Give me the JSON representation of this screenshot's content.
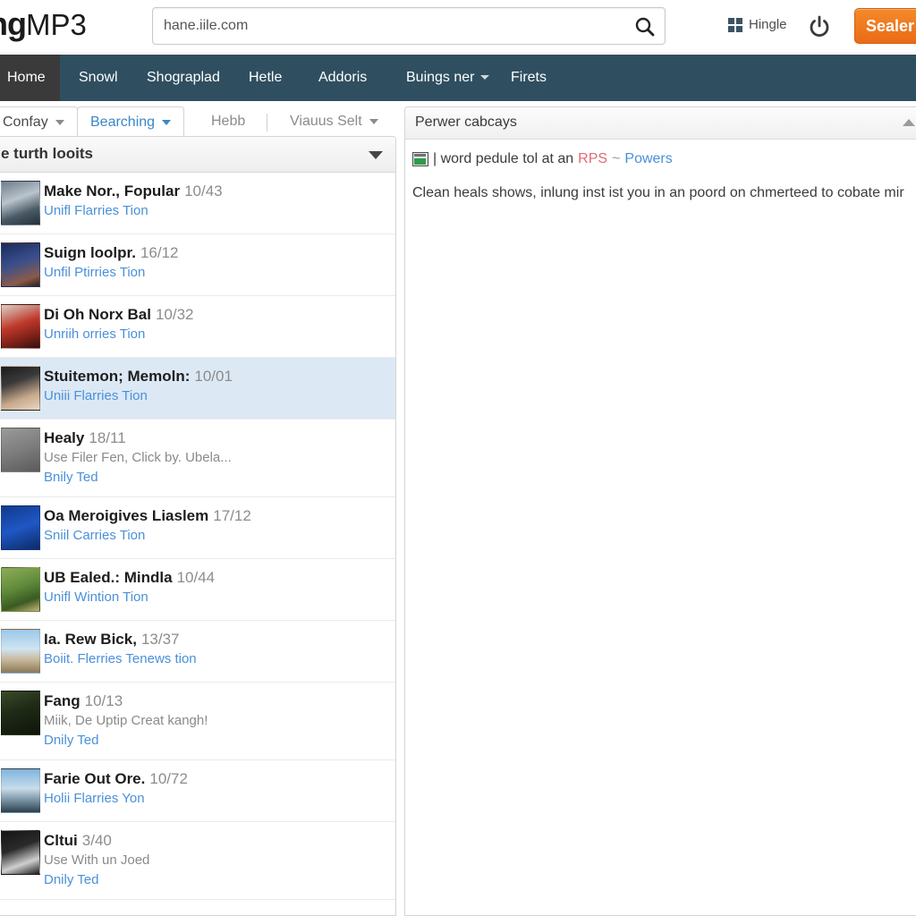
{
  "header": {
    "logo_bold": "ing",
    "logo_thin": "MP3",
    "search": {
      "value": "hane.iile.com",
      "placeholder": "hane.iile.com",
      "icon": "search-icon"
    },
    "hingle_label": "Hingle",
    "hingle_icon": "windows-grid-icon",
    "power_icon": "power-icon",
    "sealer_label": "Sealer"
  },
  "nav": {
    "items": [
      {
        "label": "Home",
        "active": true,
        "caret": false
      },
      {
        "label": "Snowl",
        "active": false,
        "caret": false
      },
      {
        "label": "Shograplad",
        "active": false,
        "caret": false
      },
      {
        "label": "Hetle",
        "active": false,
        "caret": false
      },
      {
        "label": "Addoris",
        "active": false,
        "caret": false
      },
      {
        "label": "Buings ner",
        "active": false,
        "caret": true
      },
      {
        "label": "Firets",
        "active": false,
        "caret": false
      }
    ]
  },
  "tabs": [
    {
      "label": "Confay",
      "state": "plain",
      "caret": "gray"
    },
    {
      "label": "Bearching",
      "state": "current",
      "caret": "blue"
    },
    {
      "label": "Hebb",
      "state": "flat",
      "caret": "none"
    },
    {
      "label": "Viauus Selt",
      "state": "flat",
      "caret": "gray"
    }
  ],
  "list": {
    "title": "e turth looits",
    "collapse_icon": "chevron-down-icon",
    "items": [
      {
        "title": "Make Nor., Fopular",
        "num": "10/43",
        "sub": null,
        "link": "Unifl Flarries Tion",
        "selected": false,
        "thumb": "linear-gradient(160deg,#6e7d8c 0%,#b9c4cc 40%,#4a5a66 70%,#23303a 100%)"
      },
      {
        "title": "Suign loolpr.",
        "num": "16/12",
        "sub": null,
        "link": "Unfil Ptirries Tion",
        "selected": false,
        "thumb": "linear-gradient(160deg,#1a2b5a 0%,#3a4f8c 45%,#8a5a4a 80%,#2b1d18 100%)"
      },
      {
        "title": "Di Oh Norx Bal",
        "num": "10/32",
        "sub": null,
        "link": "Unriih orries Tion",
        "selected": false,
        "thumb": "linear-gradient(160deg,#d8d2c8 0%,#c0392b 45%,#7a2018 75%,#2d1210 100%)"
      },
      {
        "title": "Stuitemon; Memoln:",
        "num": "10/01",
        "sub": null,
        "link": "Uniii Flarries Tion",
        "selected": true,
        "thumb": "linear-gradient(160deg,#1b1b1b 0%,#3a3a3a 35%,#c8a98c 70%,#e8d7c4 100%)"
      },
      {
        "title": "Healy",
        "num": "18/11",
        "sub": "Use Filer Fen, Click by. Ubela...",
        "link": "Bnily Ted",
        "selected": false,
        "thumb": "linear-gradient(160deg,#9a9a9a 0%,#7d7d7d 50%,#5a5a5a 100%)"
      },
      {
        "title": "Oa Meroigives Liaslem",
        "num": "17/12",
        "sub": null,
        "link": "Sniil Carries Tion",
        "selected": false,
        "thumb": "linear-gradient(160deg,#123a8c 0%,#1f57c4 50%,#0d2a66 100%)"
      },
      {
        "title": "UB Ealed.: Mindla",
        "num": "10/44",
        "sub": null,
        "link": "Unifl Wintion Tion",
        "selected": false,
        "thumb": "linear-gradient(160deg,#8fae5a 0%,#5f8a3a 45%,#3a5a22 75%,#c8b47a 100%)"
      },
      {
        "title": "Ia. Rew Bick,",
        "num": "13/37",
        "sub": null,
        "link": "Boiit. Flerries Tenews tion",
        "selected": false,
        "thumb": "linear-gradient(180deg,#9cc8e8 0%,#cfe4f2 45%,#c8b89a 70%,#8a7a5a 100%)"
      },
      {
        "title": "Fang",
        "num": "10/13",
        "sub": "Miik, De Uptip Creat kangh!",
        "link": "Dnily Ted",
        "selected": false,
        "thumb": "linear-gradient(160deg,#3a4a2a 0%,#1f2a16 45%,#0f1409 100%)"
      },
      {
        "title": "Farie Out Ore.",
        "num": "10/72",
        "sub": null,
        "link": "Holii Flarries Yon",
        "selected": false,
        "thumb": "linear-gradient(180deg,#7fb4dc 0%,#c9dceb 45%,#6f8a9a 75%,#2f3f4a 100%)"
      },
      {
        "title": "Cltui",
        "num": "3/40",
        "sub": "Use With un Joed",
        "link": "Dnily Ted",
        "selected": false,
        "thumb": "linear-gradient(160deg,#151515 0%,#2a2a2a 40%,#cfcfcf 72%,#1a1a1a 100%)"
      }
    ]
  },
  "right": {
    "title": "Perwer cabcays",
    "line1": {
      "icon": "image-thumbnail-icon",
      "pre": "| word pedule tol at an ",
      "red": "RPS",
      "tilde": " ~ ",
      "blue": "Powers"
    },
    "line2": "Clean heals shows, inlung inst ist you in an poord on chmerteed to cobate mir",
    "collapse_icon": "chevron-up-icon"
  },
  "colors": {
    "navbar": "#2f4f60",
    "accent_orange": "#ea6b16",
    "link_blue": "#4a90d9",
    "selected_row": "#dce9f5"
  }
}
